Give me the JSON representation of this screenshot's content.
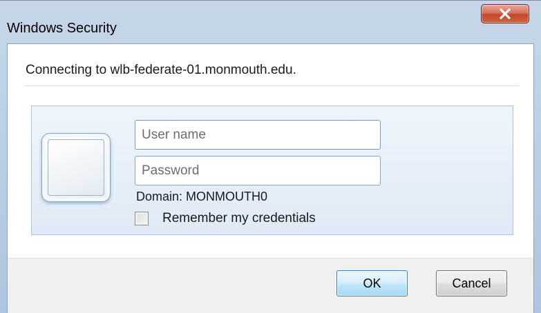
{
  "window": {
    "title": "Windows Security",
    "close_icon": "close-x-icon"
  },
  "message": {
    "connecting": "Connecting to wlb-federate-01.monmouth.edu."
  },
  "credentials": {
    "user_tile_icon": "user-tile-icon",
    "username": {
      "value": "",
      "placeholder": "User name"
    },
    "password": {
      "value": "",
      "placeholder": "Password"
    },
    "domain": "Domain: MONMOUTH0",
    "remember": {
      "label": "Remember my credentials",
      "checked": false
    }
  },
  "buttons": {
    "ok": "OK",
    "cancel": "Cancel"
  },
  "colors": {
    "close_button": "#c4462b",
    "panel_border": "#a9c4e0",
    "ok_border": "#3c7fb1"
  }
}
